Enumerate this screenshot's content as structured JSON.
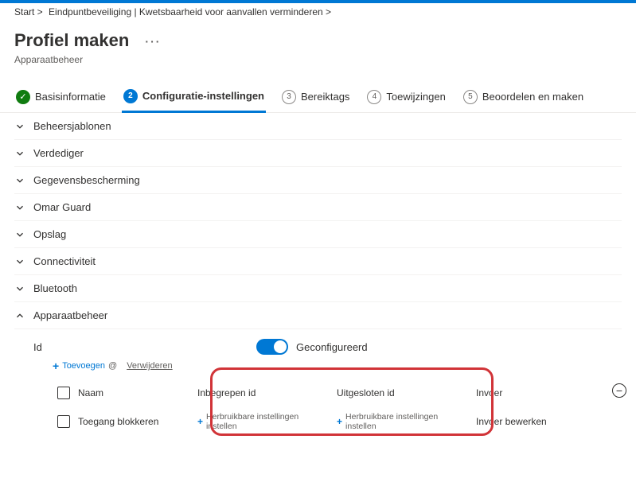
{
  "breadcrumb": {
    "start": "Start >",
    "path": "Eindpuntbeveiliging | Kwetsbaarheid voor aanvallen verminderen >"
  },
  "page": {
    "title": "Profiel maken",
    "more": "···",
    "subtitle": "Apparaatbeheer"
  },
  "wizard": {
    "steps": [
      {
        "num": "",
        "label": "Basisinformatie",
        "state": "done"
      },
      {
        "num": "2",
        "label": "Configuratie-instellingen",
        "state": "current"
      },
      {
        "num": "3",
        "label": "Bereiktags",
        "state": "pending"
      },
      {
        "num": "4",
        "label": "Toewijzingen",
        "state": "pending"
      },
      {
        "num": "5",
        "label": "Beoordelen en maken",
        "state": "pending"
      }
    ]
  },
  "accordion": {
    "items": [
      {
        "label": "Beheersjablonen",
        "open": false
      },
      {
        "label": "Verdediger",
        "open": false
      },
      {
        "label": "Gegevensbescherming",
        "open": false
      },
      {
        "label": "Omar Guard",
        "open": false
      },
      {
        "label": "Opslag",
        "open": false
      },
      {
        "label": "Connectiviteit",
        "open": false
      },
      {
        "label": "Bluetooth",
        "open": false
      },
      {
        "label": "Apparaatbeheer",
        "open": true
      }
    ]
  },
  "deviceCtrl": {
    "field_label": "Id",
    "toggle_label": "Geconfigureerd",
    "toolbar": {
      "add": "Toevoegen",
      "add_icon_extra": "@",
      "delete": "Verwijderen"
    },
    "grid": {
      "headers": {
        "name": "Naam",
        "included": "Inbegrepen id",
        "excluded": "Uitgesloten id",
        "entry": "Invoer"
      },
      "row": {
        "name": "Toegang blokkeren",
        "included": "Herbruikbare instellingen instellen",
        "excluded": "Herbruikbare instellingen instellen",
        "entry": "Invoer bewerken"
      }
    }
  }
}
